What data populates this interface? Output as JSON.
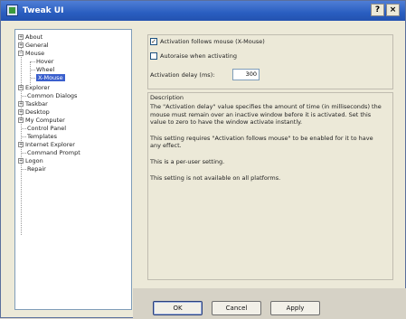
{
  "window": {
    "title": "Tweak UI",
    "help_label": "?",
    "close_label": "×"
  },
  "tree": {
    "items": [
      {
        "label": "About",
        "expander": "+"
      },
      {
        "label": "General",
        "expander": "+"
      },
      {
        "label": "Mouse",
        "expander": "−"
      },
      {
        "label": "Hover",
        "expander": ""
      },
      {
        "label": "Wheel",
        "expander": ""
      },
      {
        "label": "X-Mouse",
        "expander": ""
      },
      {
        "label": "Explorer",
        "expander": "+"
      },
      {
        "label": "Common Dialogs",
        "expander": ""
      },
      {
        "label": "Taskbar",
        "expander": "+"
      },
      {
        "label": "Desktop",
        "expander": "+"
      },
      {
        "label": "My Computer",
        "expander": "+"
      },
      {
        "label": "Control Panel",
        "expander": ""
      },
      {
        "label": "Templates",
        "expander": ""
      },
      {
        "label": "Internet Explorer",
        "expander": "+"
      },
      {
        "label": "Command Prompt",
        "expander": ""
      },
      {
        "label": "Logon",
        "expander": "+"
      },
      {
        "label": "Repair",
        "expander": ""
      }
    ]
  },
  "settings": {
    "follow_mouse": {
      "label": "Activation follows mouse (X-Mouse)",
      "checked": true,
      "mark": "✓"
    },
    "autoraise": {
      "label": "Autoraise when activating",
      "checked": false,
      "mark": ""
    },
    "delay_label": "Activation delay (ms):",
    "delay_value": "300"
  },
  "description": {
    "title": "Description",
    "paragraphs": [
      "The \"Activation delay\" value specifies the amount of time (in milliseconds) the mouse must remain over an inactive window before it is activated. Set this value to zero to have the window activate instantly.",
      "This setting requires \"Activation follows mouse\" to be enabled for it to have any effect.",
      "This is a per-user setting.",
      "This setting is not available on all platforms."
    ]
  },
  "buttons": {
    "ok": "OK",
    "cancel": "Cancel",
    "apply": "Apply"
  }
}
